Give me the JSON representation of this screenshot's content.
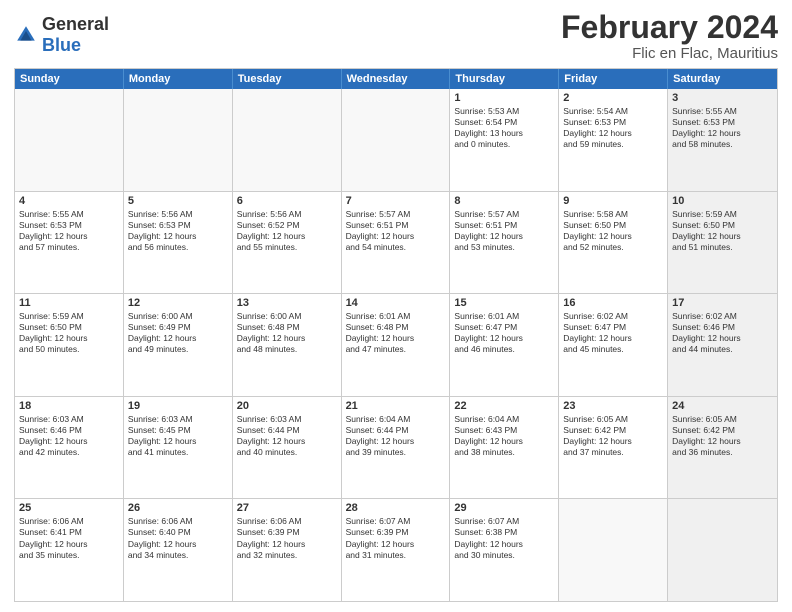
{
  "header": {
    "logo": {
      "general": "General",
      "blue": "Blue"
    },
    "title": "February 2024",
    "subtitle": "Flic en Flac, Mauritius"
  },
  "calendar": {
    "days": [
      "Sunday",
      "Monday",
      "Tuesday",
      "Wednesday",
      "Thursday",
      "Friday",
      "Saturday"
    ],
    "rows": [
      [
        {
          "empty": true
        },
        {
          "empty": true
        },
        {
          "empty": true
        },
        {
          "empty": true
        },
        {
          "day": 1,
          "lines": [
            "Sunrise: 5:53 AM",
            "Sunset: 6:54 PM",
            "Daylight: 13 hours",
            "and 0 minutes."
          ]
        },
        {
          "day": 2,
          "lines": [
            "Sunrise: 5:54 AM",
            "Sunset: 6:53 PM",
            "Daylight: 12 hours",
            "and 59 minutes."
          ]
        },
        {
          "day": 3,
          "shaded": true,
          "lines": [
            "Sunrise: 5:55 AM",
            "Sunset: 6:53 PM",
            "Daylight: 12 hours",
            "and 58 minutes."
          ]
        }
      ],
      [
        {
          "day": 4,
          "lines": [
            "Sunrise: 5:55 AM",
            "Sunset: 6:53 PM",
            "Daylight: 12 hours",
            "and 57 minutes."
          ]
        },
        {
          "day": 5,
          "lines": [
            "Sunrise: 5:56 AM",
            "Sunset: 6:53 PM",
            "Daylight: 12 hours",
            "and 56 minutes."
          ]
        },
        {
          "day": 6,
          "lines": [
            "Sunrise: 5:56 AM",
            "Sunset: 6:52 PM",
            "Daylight: 12 hours",
            "and 55 minutes."
          ]
        },
        {
          "day": 7,
          "lines": [
            "Sunrise: 5:57 AM",
            "Sunset: 6:51 PM",
            "Daylight: 12 hours",
            "and 54 minutes."
          ]
        },
        {
          "day": 8,
          "lines": [
            "Sunrise: 5:57 AM",
            "Sunset: 6:51 PM",
            "Daylight: 12 hours",
            "and 53 minutes."
          ]
        },
        {
          "day": 9,
          "lines": [
            "Sunrise: 5:58 AM",
            "Sunset: 6:50 PM",
            "Daylight: 12 hours",
            "and 52 minutes."
          ]
        },
        {
          "day": 10,
          "shaded": true,
          "lines": [
            "Sunrise: 5:59 AM",
            "Sunset: 6:50 PM",
            "Daylight: 12 hours",
            "and 51 minutes."
          ]
        }
      ],
      [
        {
          "day": 11,
          "lines": [
            "Sunrise: 5:59 AM",
            "Sunset: 6:50 PM",
            "Daylight: 12 hours",
            "and 50 minutes."
          ]
        },
        {
          "day": 12,
          "lines": [
            "Sunrise: 6:00 AM",
            "Sunset: 6:49 PM",
            "Daylight: 12 hours",
            "and 49 minutes."
          ]
        },
        {
          "day": 13,
          "lines": [
            "Sunrise: 6:00 AM",
            "Sunset: 6:48 PM",
            "Daylight: 12 hours",
            "and 48 minutes."
          ]
        },
        {
          "day": 14,
          "lines": [
            "Sunrise: 6:01 AM",
            "Sunset: 6:48 PM",
            "Daylight: 12 hours",
            "and 47 minutes."
          ]
        },
        {
          "day": 15,
          "lines": [
            "Sunrise: 6:01 AM",
            "Sunset: 6:47 PM",
            "Daylight: 12 hours",
            "and 46 minutes."
          ]
        },
        {
          "day": 16,
          "lines": [
            "Sunrise: 6:02 AM",
            "Sunset: 6:47 PM",
            "Daylight: 12 hours",
            "and 45 minutes."
          ]
        },
        {
          "day": 17,
          "shaded": true,
          "lines": [
            "Sunrise: 6:02 AM",
            "Sunset: 6:46 PM",
            "Daylight: 12 hours",
            "and 44 minutes."
          ]
        }
      ],
      [
        {
          "day": 18,
          "lines": [
            "Sunrise: 6:03 AM",
            "Sunset: 6:46 PM",
            "Daylight: 12 hours",
            "and 42 minutes."
          ]
        },
        {
          "day": 19,
          "lines": [
            "Sunrise: 6:03 AM",
            "Sunset: 6:45 PM",
            "Daylight: 12 hours",
            "and 41 minutes."
          ]
        },
        {
          "day": 20,
          "lines": [
            "Sunrise: 6:03 AM",
            "Sunset: 6:44 PM",
            "Daylight: 12 hours",
            "and 40 minutes."
          ]
        },
        {
          "day": 21,
          "lines": [
            "Sunrise: 6:04 AM",
            "Sunset: 6:44 PM",
            "Daylight: 12 hours",
            "and 39 minutes."
          ]
        },
        {
          "day": 22,
          "lines": [
            "Sunrise: 6:04 AM",
            "Sunset: 6:43 PM",
            "Daylight: 12 hours",
            "and 38 minutes."
          ]
        },
        {
          "day": 23,
          "lines": [
            "Sunrise: 6:05 AM",
            "Sunset: 6:42 PM",
            "Daylight: 12 hours",
            "and 37 minutes."
          ]
        },
        {
          "day": 24,
          "shaded": true,
          "lines": [
            "Sunrise: 6:05 AM",
            "Sunset: 6:42 PM",
            "Daylight: 12 hours",
            "and 36 minutes."
          ]
        }
      ],
      [
        {
          "day": 25,
          "lines": [
            "Sunrise: 6:06 AM",
            "Sunset: 6:41 PM",
            "Daylight: 12 hours",
            "and 35 minutes."
          ]
        },
        {
          "day": 26,
          "lines": [
            "Sunrise: 6:06 AM",
            "Sunset: 6:40 PM",
            "Daylight: 12 hours",
            "and 34 minutes."
          ]
        },
        {
          "day": 27,
          "lines": [
            "Sunrise: 6:06 AM",
            "Sunset: 6:39 PM",
            "Daylight: 12 hours",
            "and 32 minutes."
          ]
        },
        {
          "day": 28,
          "lines": [
            "Sunrise: 6:07 AM",
            "Sunset: 6:39 PM",
            "Daylight: 12 hours",
            "and 31 minutes."
          ]
        },
        {
          "day": 29,
          "lines": [
            "Sunrise: 6:07 AM",
            "Sunset: 6:38 PM",
            "Daylight: 12 hours",
            "and 30 minutes."
          ]
        },
        {
          "empty": true
        },
        {
          "empty": true,
          "shaded": true
        }
      ]
    ]
  }
}
